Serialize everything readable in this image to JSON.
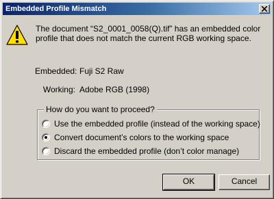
{
  "window": {
    "title": "Embedded Profile Mismatch",
    "close_icon": "close-x-icon"
  },
  "message": {
    "icon": "warning-triangle-icon",
    "text": "The document “S2_0001_0058(Q).tif” has an embedded color profile that does not match the current RGB working space."
  },
  "profiles": {
    "embedded_label": "Embedded:",
    "embedded_value": "Fuji S2 Raw",
    "working_label": "Working:",
    "working_value": "Adobe RGB (1998)"
  },
  "proceed": {
    "legend": "How do you want to proceed?",
    "options": [
      {
        "label": "Use the embedded profile (instead of the working space)",
        "selected": false
      },
      {
        "label": "Convert document’s colors to the working space",
        "selected": true
      },
      {
        "label": "Discard the embedded profile (don’t color manage)",
        "selected": false
      }
    ]
  },
  "buttons": {
    "ok": "OK",
    "cancel": "Cancel"
  },
  "colors": {
    "title_gradient_start": "#0a246a",
    "title_gradient_end": "#a6caf0",
    "face": "#d4d0c8",
    "warning_fill": "#ffde00"
  }
}
